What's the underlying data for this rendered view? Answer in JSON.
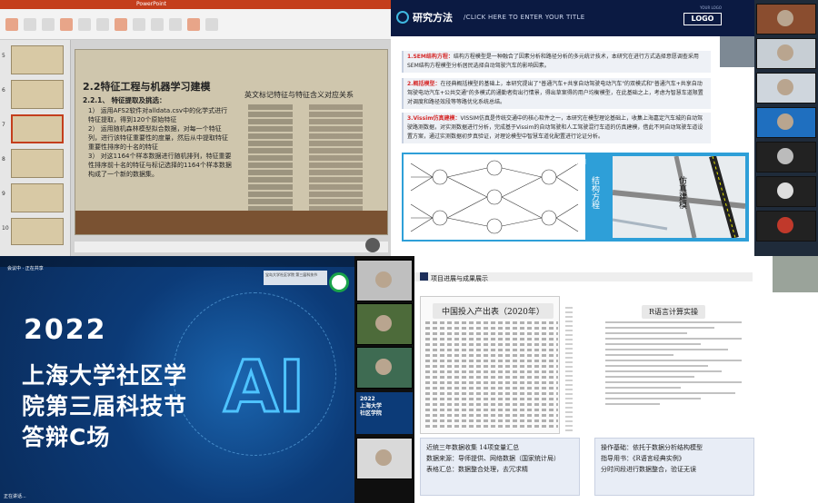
{
  "q1": {
    "app_title": "PowerPoint",
    "slide_numbers": [
      "5",
      "6",
      "7",
      "8",
      "9",
      "10"
    ],
    "title": "2.2特征工程与机器学习建模",
    "subtitle": "2.2.1、 特征提取及挑选：",
    "points": [
      "1） 运用AFS2软件对alldata.csv中的化学式进行特征提取，得到120个原始特征",
      "2） 运用随机森林模型拟合数据，对每一个特征列，进行该特征重要性的度量，然后从中提取特征重要性排序的十名的特征",
      "3） 对这1164个样本数据进行随机排列，特征重要性排序前十名的特征与标记选择的1164个样本数据构成了一个新的数据集。"
    ],
    "table_title": "英文标记特征与特征含义对应关系"
  },
  "q2": {
    "section_title": "研究方法",
    "section_sub": "/CLICK HERE TO ENTER YOUR TITLE",
    "logo": "LOGO",
    "logo_small": "YOUR LOGO",
    "paras": [
      {
        "head": "1.SEM结构方程：",
        "text": "结构方程模型是一种融合了因素分析和路径分析的多元统计技术，本研究在进行方式选择意愿调查采用SEM结构方程模型分析居民选择自动驾驶汽车的影响因素。"
      },
      {
        "head": "2.概括模型：",
        "text": "在径典概括模型的基础上，本研究提出了\"普通汽车+共享自动驾驶电动汽车\"的双模式和\"普通汽车+共享自动驾驶电动汽车+公共交通\"的多模式的通勤者街出行情景，得出草案得的用户均衡模型，在此基础之上，考虑为智慧车道限置对调度和路径效段等等路优化系统总结。"
      },
      {
        "head": "3.Vissim仿真建模：",
        "text": "VISSIM仿真是传统交通中的核心软件之一，本研究在模型理论基础上，收集上海嘉定汽车城的自动驾驶路测数据，对实测数据进行分析，完成基于Vissim的自动驾驶和人工驾驶混行车道的仿真建模，借此不同自动驾驶车道设置方案，通过实测数据初步真验证，对理论模型中智慧车道化配置进行论证分析。"
      }
    ],
    "panel_label_sem": "SEM",
    "panel_label_v1": "结构方程",
    "panel_label_v2": "仿真建模"
  },
  "q4": {
    "topbar": "会议中 · 正在共享",
    "year": "2022",
    "lines": [
      "上海大学社区学",
      "院第三届科技节",
      "答辩C场"
    ],
    "big": "AI",
    "badge": "宝岛大学社区学院 第三届科技节",
    "foot": "正在讲话..."
  },
  "q5": {
    "mini": [
      "2022",
      "上海大学",
      "社区学院"
    ]
  },
  "q6": {
    "header": "项目进展与成果展示",
    "left_title": "中国投入产出表（2020年）",
    "right_title": "R语言计算实操",
    "box_left": [
      "近统三年数据收集      14项变量汇总",
      "数据来源：导师提供、网络数据（国家统计局）",
      "表格汇总：数据整合处理，去冗求精"
    ],
    "box_right": [
      "操作基础：依托于数据分析结构模型",
      "指导用书：《R语言经典实例》",
      "分时间段进行数据整合，验证无误"
    ]
  }
}
